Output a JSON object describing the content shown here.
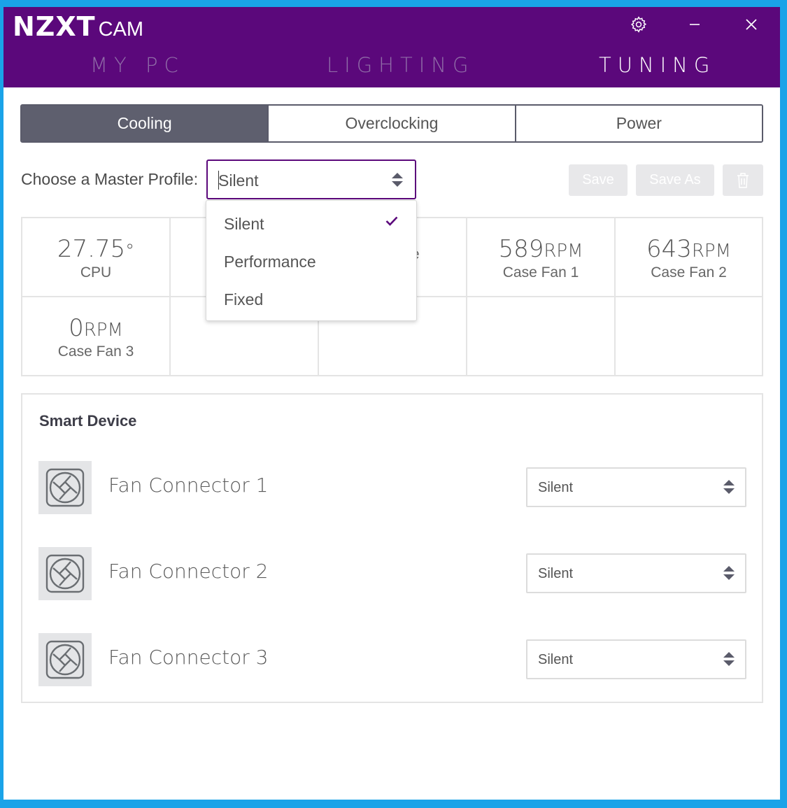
{
  "app": {
    "logo_main": "NZXT",
    "logo_sub": "CAM"
  },
  "window_controls": {
    "settings": "gear-icon",
    "minimize": "minimize-icon",
    "close": "close-icon"
  },
  "nav": {
    "tabs": [
      {
        "label": "MY PC"
      },
      {
        "label": "LIGHTING"
      },
      {
        "label": "TUNING",
        "active": true
      }
    ]
  },
  "subtabs": [
    {
      "label": "Cooling",
      "active": true
    },
    {
      "label": "Overclocking"
    },
    {
      "label": "Power"
    }
  ],
  "profile": {
    "label": "Choose a Master Profile:",
    "selected": "Silent",
    "options": [
      {
        "label": "Silent",
        "checked": true
      },
      {
        "label": "Performance"
      },
      {
        "label": "Fixed"
      }
    ]
  },
  "buttons": {
    "save": "Save",
    "save_as": "Save As",
    "delete_icon": "trash-icon"
  },
  "stats": [
    {
      "value": "27.75",
      "unit": "°",
      "label": "CPU"
    },
    {
      "value": "",
      "unit": "",
      "label": ""
    },
    {
      "value": "",
      "unit": "",
      "label": "se"
    },
    {
      "value": "589",
      "unit": "RPM",
      "label": "Case Fan 1"
    },
    {
      "value": "643",
      "unit": "RPM",
      "label": "Case Fan 2"
    },
    {
      "value": "0",
      "unit": "RPM",
      "label": "Case Fan 3"
    }
  ],
  "smart_device": {
    "title": "Smart Device",
    "connectors": [
      {
        "name": "Fan Connector 1",
        "profile": "Silent"
      },
      {
        "name": "Fan Connector 2",
        "profile": "Silent"
      },
      {
        "name": "Fan Connector 3",
        "profile": "Silent"
      }
    ]
  },
  "colors": {
    "header": "#5b087b",
    "accent": "#5b087b",
    "active_tab": "#5e5f6e",
    "desktop": "#1aa3e8"
  }
}
